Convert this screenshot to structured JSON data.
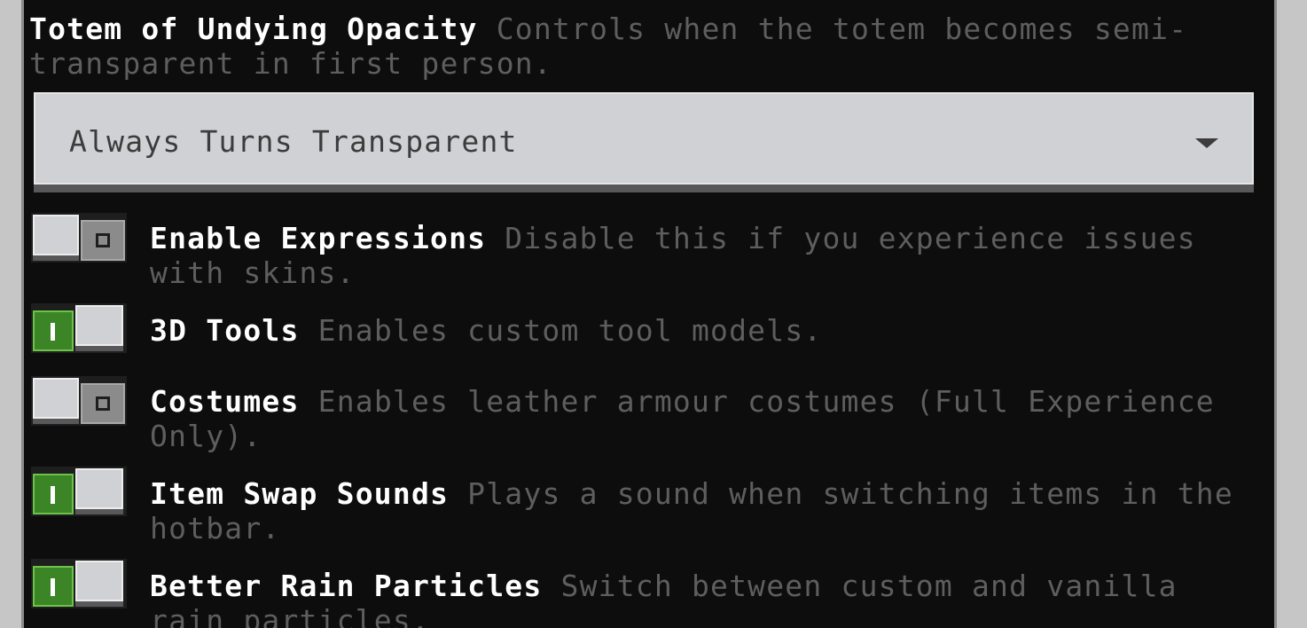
{
  "totem": {
    "title": "Totem of Undying Opacity",
    "description": "Controls when the totem becomes semi-transparent in first person.",
    "dropdown_value": "Always Turns Transparent"
  },
  "toggles": [
    {
      "title": "Enable Expressions",
      "description": "Disable this if you experience issues with skins.",
      "state": "off"
    },
    {
      "title": "3D Tools",
      "description": "Enables custom tool models.",
      "state": "on"
    },
    {
      "title": "Costumes",
      "description": "Enables leather armour costumes (Full Experience Only).",
      "state": "off"
    },
    {
      "title": "Item Swap Sounds",
      "description": "Plays a sound when switching items in the hotbar.",
      "state": "on"
    },
    {
      "title": "Better Rain Particles",
      "description": "Switch between custom and vanilla rain particles.",
      "state": "on"
    }
  ],
  "colors": {
    "panel_bg": "#0d0d0d",
    "title_text": "#ffffff",
    "desc_text": "#5e5e5e",
    "toggle_on": "#3c8527",
    "toggle_off": "#8b8b8b"
  }
}
